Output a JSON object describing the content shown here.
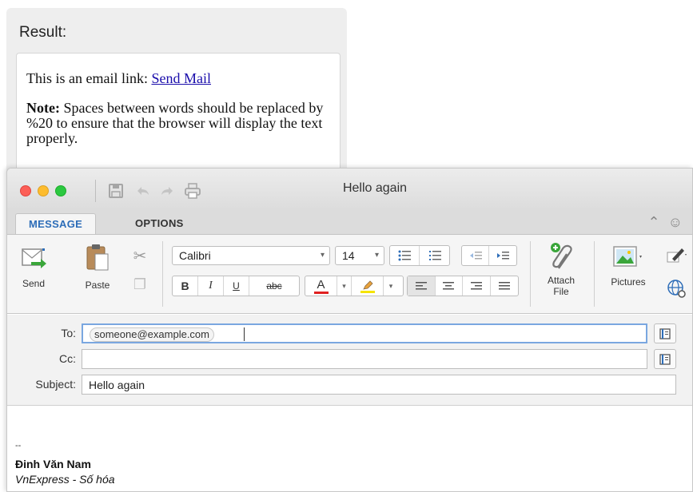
{
  "result": {
    "heading": "Result:",
    "email_prefix": "This is an email link: ",
    "email_link": "Send Mail",
    "note_label": "Note:",
    "note_text": " Spaces between words should be replaced by %20 to ensure that the browser will display the text properly."
  },
  "window": {
    "title": "Hello again"
  },
  "tabs": [
    {
      "label": "MESSAGE",
      "active": true
    },
    {
      "label": "OPTIONS",
      "active": false
    }
  ],
  "ribbon": {
    "send_label": "Send",
    "paste_label": "Paste",
    "font_name": "Calibri",
    "font_size": "14",
    "bold": "B",
    "italic": "I",
    "underline": "U",
    "strike": "abc",
    "font_color": "A",
    "attach_label_1": "Attach",
    "attach_label_2": "File",
    "pictures_label": "Pictures"
  },
  "address": {
    "to_label": "To:",
    "to_recipient": "someone@example.com",
    "cc_label": "Cc:",
    "cc_value": "",
    "subject_label": "Subject:",
    "subject_value": "Hello again"
  },
  "signature": {
    "dash": "--",
    "name": "Đinh Văn Nam",
    "org": "VnExpress - Số hóa"
  },
  "colors": {
    "accent": "#2d6db8",
    "link": "#1a0dab",
    "send_arrow": "#3aa63a",
    "font_color_bar": "#e02020",
    "highlight_bar": "#f5e400"
  }
}
